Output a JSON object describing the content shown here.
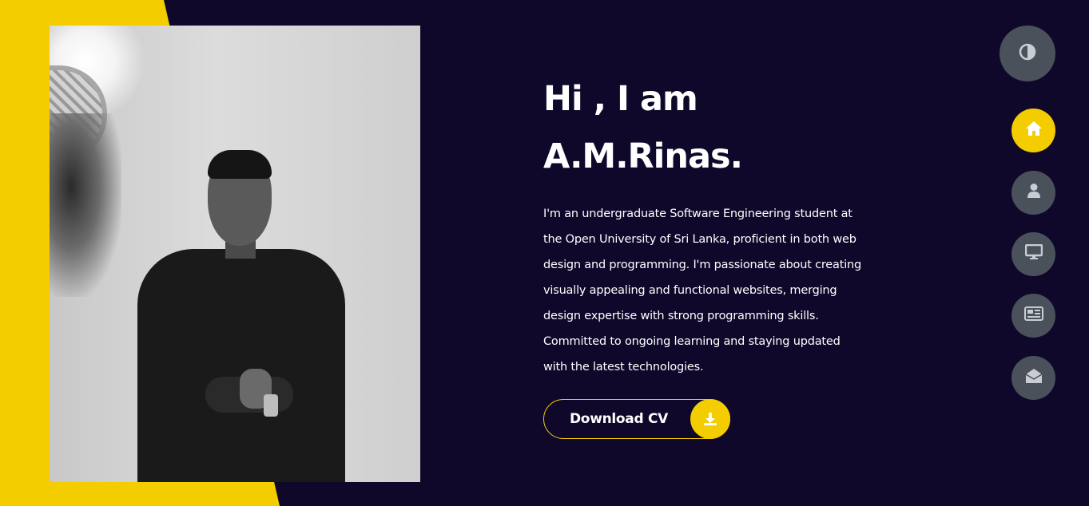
{
  "hero": {
    "greeting": "Hi , I am",
    "name": "A.M.Rinas.",
    "description": "I'm an undergraduate Software Engineering student at the Open University of Sri Lanka, proficient in both web design and programming. I'm passionate about creating visually appealing and functional websites, merging design expertise with strong programming skills. Committed to ongoing learning and staying updated with the latest technologies.",
    "download_label": "Download CV",
    "download_icon": "download-icon"
  },
  "profile_photo": {
    "alt": "A.M.Rinas portrait",
    "style": "black-and-white"
  },
  "theme_toggle": {
    "icon": "contrast-icon"
  },
  "nav": {
    "items": [
      {
        "id": "home",
        "icon": "home-icon",
        "active": true
      },
      {
        "id": "about",
        "icon": "user-icon",
        "active": false
      },
      {
        "id": "portfolio",
        "icon": "desktop-icon",
        "active": false
      },
      {
        "id": "blog",
        "icon": "newspaper-icon",
        "active": false
      },
      {
        "id": "contact",
        "icon": "envelope-open-icon",
        "active": false
      }
    ]
  },
  "colors": {
    "background": "#0f082b",
    "accent": "#f3cd00",
    "nav_button": "#4a515b",
    "nav_icon": "#c9cdd3",
    "text": "#ffffff"
  }
}
